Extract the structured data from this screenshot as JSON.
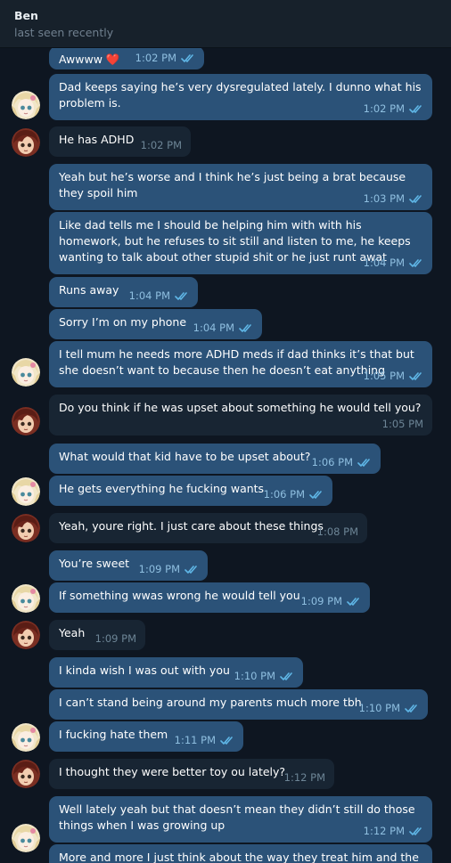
{
  "header": {
    "name": "Ben",
    "status": "last seen recently"
  },
  "messages": [
    {
      "text": "Awwww ❤️",
      "time": "1:02 PM"
    },
    {
      "text": "Dad keeps saying he’s very dysregulated lately. I dunno what his problem is.",
      "time": "1:02 PM"
    },
    {
      "text": "He has ADHD",
      "time": "1:02 PM"
    },
    {
      "text": "Yeah but he’s worse and I think he’s just being a brat because they spoil him",
      "time": "1:03 PM"
    },
    {
      "text": "Like dad tells me I should be helping him with with his homework, but he refuses to sit still and listen to me, he keeps wanting to talk about other stupid shit or he just runt awat",
      "time": "1:04 PM"
    },
    {
      "text": "Runs away",
      "time": "1:04 PM"
    },
    {
      "text": "Sorry I’m on my phone",
      "time": "1:04 PM"
    },
    {
      "text": "I tell mum he needs more ADHD meds if dad thinks it’s that but she doesn’t want to because then he doesn’t eat anything",
      "time": "1:05 PM"
    },
    {
      "text": "Do you think if he was upset about something he would tell you?",
      "time": "1:05 PM"
    },
    {
      "text": "What would that kid have to be upset about?",
      "time": "1:06 PM"
    },
    {
      "text": "He gets everything he fucking wants",
      "time": "1:06 PM"
    },
    {
      "text": "Yeah, youre right. I just care about these things",
      "time": "1:08 PM"
    },
    {
      "text": "You’re sweet",
      "time": "1:09 PM"
    },
    {
      "text": "If something wwas wrong he would tell you",
      "time": "1:09 PM"
    },
    {
      "text": "Yeah",
      "time": "1:09 PM"
    },
    {
      "text": "I kinda wish I was out with you",
      "time": "1:10 PM"
    },
    {
      "text": "I can’t stand being around my parents much more tbh",
      "time": "1:10 PM"
    },
    {
      "text": "I fucking hate them",
      "time": "1:11 PM"
    },
    {
      "text": "I thought they were better toy ou lately?",
      "time": "1:12 PM"
    },
    {
      "text": "Well lately yeah but that doesn’t mean they didn’t still do those things when I was growing up",
      "time": "1:12 PM"
    },
    {
      "text": "More and more I just think about the way they treat him and the",
      "time": ""
    }
  ]
}
